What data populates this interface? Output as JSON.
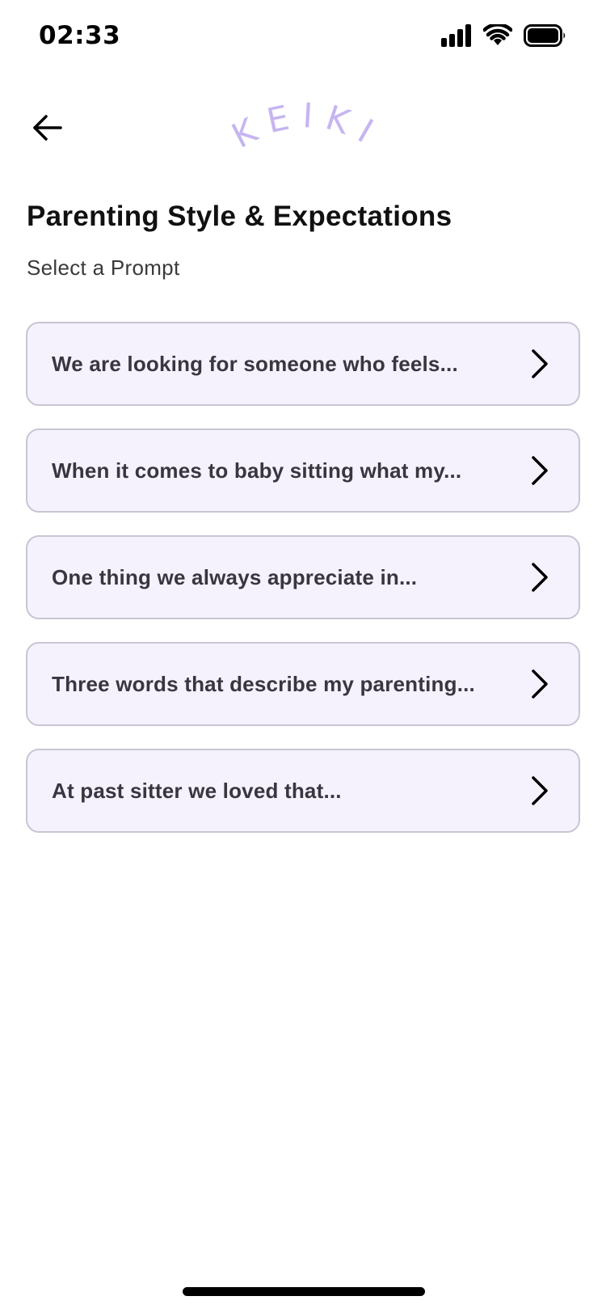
{
  "status_bar": {
    "time": "02:33",
    "icons": [
      "signal-icon",
      "wifi-icon",
      "battery-icon"
    ]
  },
  "header": {
    "back_icon": "arrow-left-icon",
    "logo_text": "KEIKI",
    "logo_color": "#c6b5f1"
  },
  "page": {
    "title": "Parenting Style & Expectations",
    "subtitle": "Select a Prompt"
  },
  "prompts": [
    {
      "label": "We are looking for someone who feels..."
    },
    {
      "label": "When it comes to baby sitting what my..."
    },
    {
      "label": "One thing we always appreciate in..."
    },
    {
      "label": "Three words that describe my parenting..."
    },
    {
      "label": "At past sitter we loved that..."
    }
  ],
  "colors": {
    "card_background": "#f5f2fe",
    "card_border": "#c9c6d3",
    "text_primary": "#111111"
  }
}
